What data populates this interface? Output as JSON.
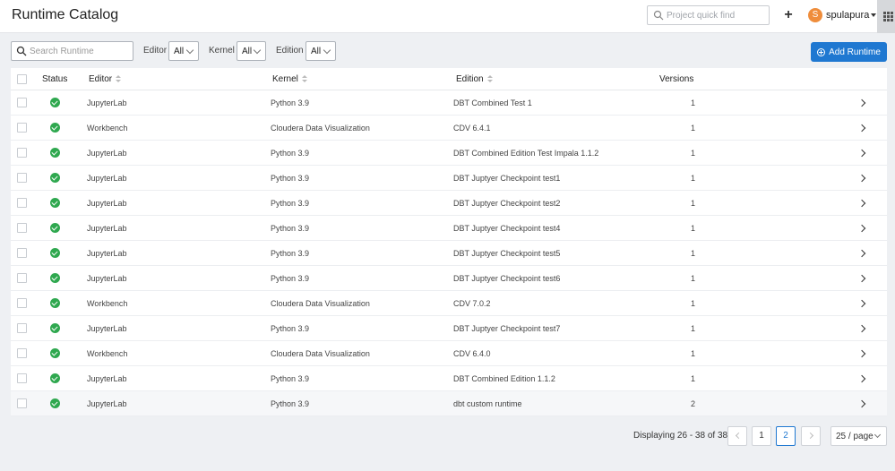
{
  "header": {
    "title": "Runtime Catalog",
    "quick_find_placeholder": "Project quick find",
    "user_initial": "S",
    "username": "spulapura"
  },
  "filters": {
    "search_placeholder": "Search Runtime",
    "editor_label": "Editor",
    "editor_value": "All",
    "kernel_label": "Kernel",
    "kernel_value": "All",
    "edition_label": "Edition",
    "edition_value": "All",
    "add_button_label": "Add Runtime"
  },
  "table": {
    "columns": [
      "Status",
      "Editor",
      "Kernel",
      "Edition",
      "Versions"
    ],
    "rows": [
      {
        "editor": "JupyterLab",
        "kernel": "Python 3.9",
        "edition": "DBT Combined Test 1",
        "versions": "1"
      },
      {
        "editor": "Workbench",
        "kernel": "Cloudera Data Visualization",
        "edition": "CDV 6.4.1",
        "versions": "1"
      },
      {
        "editor": "JupyterLab",
        "kernel": "Python 3.9",
        "edition": "DBT Combined Edition Test Impala 1.1.2",
        "versions": "1"
      },
      {
        "editor": "JupyterLab",
        "kernel": "Python 3.9",
        "edition": "DBT Juptyer Checkpoint test1",
        "versions": "1"
      },
      {
        "editor": "JupyterLab",
        "kernel": "Python 3.9",
        "edition": "DBT Juptyer Checkpoint test2",
        "versions": "1"
      },
      {
        "editor": "JupyterLab",
        "kernel": "Python 3.9",
        "edition": "DBT Juptyer Checkpoint test4",
        "versions": "1"
      },
      {
        "editor": "JupyterLab",
        "kernel": "Python 3.9",
        "edition": "DBT Juptyer Checkpoint test5",
        "versions": "1"
      },
      {
        "editor": "JupyterLab",
        "kernel": "Python 3.9",
        "edition": "DBT Juptyer Checkpoint test6",
        "versions": "1"
      },
      {
        "editor": "Workbench",
        "kernel": "Cloudera Data Visualization",
        "edition": "CDV 7.0.2",
        "versions": "1"
      },
      {
        "editor": "JupyterLab",
        "kernel": "Python 3.9",
        "edition": "DBT Juptyer Checkpoint test7",
        "versions": "1"
      },
      {
        "editor": "Workbench",
        "kernel": "Cloudera Data Visualization",
        "edition": "CDV 6.4.0",
        "versions": "1"
      },
      {
        "editor": "JupyterLab",
        "kernel": "Python 3.9",
        "edition": "DBT Combined Edition 1.1.2",
        "versions": "1"
      },
      {
        "editor": "JupyterLab",
        "kernel": "Python 3.9",
        "edition": "dbt custom runtime",
        "versions": "2"
      }
    ]
  },
  "pagination": {
    "display_text": "Displaying 26 - 38 of 38",
    "pages": [
      "1",
      "2"
    ],
    "current_page": "2",
    "page_size": "25 / page"
  },
  "colors": {
    "accent": "#1f78d1",
    "status_ok": "#2fa84f",
    "avatar": "#ef8d3b"
  }
}
